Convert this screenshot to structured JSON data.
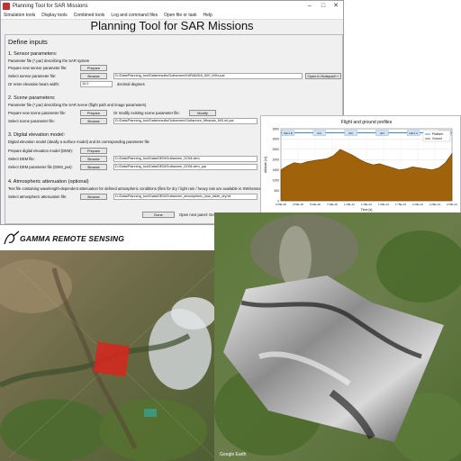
{
  "window": {
    "title": "Planning Tool for SAR Missions",
    "menu": [
      "Simulation tools",
      "Display tools",
      "Combined tools",
      "Log and command files",
      "Open file or task",
      "Help"
    ],
    "app_title": "Planning Tool for SAR Missions",
    "define_inputs": "Define inputs"
  },
  "sensor": {
    "heading": "1. Sensor parameters:",
    "desc": "Parameter file (*.par) describing the SAR system",
    "prepare_label": "Prepare new sensor parameter file:",
    "prepare_btn": "Prepare",
    "select_label": "Select sensor parameter file:",
    "browse_btn": "Browse",
    "path": "D:/Data/Planning_tool/Data/results/Guttannen/KARAMDA_600_MHz.par",
    "notepad_btn": "Open in Notepad++",
    "beam_label": "Or enter elevation beam width:",
    "beam_value": "10.0",
    "beam_unit": "decimal degrees"
  },
  "scene": {
    "heading": "2. Scene parameters:",
    "desc": "Parameter file (*.par) describing the SAR scene (flight path and image parameters)",
    "prepare_label": "Prepare new scene parameter file:",
    "prepare_btn": "Prepare",
    "modify_label": "Or modify existing scene parameter file:",
    "modify_btn": "Modify",
    "select_label": "Select scene parameter file:",
    "browse_btn": "Browse",
    "path": "D:/Data/Planning_tool/Data/results/Guttannen/Guttannen_Miranda_600.ml.par"
  },
  "dem": {
    "heading": "3. Digital elevation model:",
    "desc": "Digital elevation model (ideally a surface model) and its corresponding parameter file",
    "prepare_label": "Prepare digital elevation model (DEM):",
    "prepare_btn": "Prepare",
    "dem_label": "Select DEM file:",
    "dem_browse": "Browse",
    "dem_path": "D:/Data/Planning_tool/Data/DEM/Guttannen_DOM.dem",
    "par_label": "Select DEM parameter file (DEM_par):",
    "par_browse": "Browse",
    "par_path": "D:/Data/Planning_tool/Data/DEM/Guttannen_DOM.dem_par"
  },
  "atm": {
    "heading": "4. Atmospheric attenuation (optional)",
    "desc": "Text file containing wavelength-dependent attenuation for defined atmospheric conditions (files for dry / light rain / heavy rain are available in SW/sensors",
    "select_label": "Select atmospheric attenuation file:",
    "browse_btn": "Browse",
    "path": "D:/Data/Planning_tool/Data/DEM/Guttannen_atmospheric_loss_table_dry.txt"
  },
  "footer": {
    "done_btn": "Done",
    "next_label": "Open next panel: Ge"
  },
  "logo": {
    "brand": "GAMMA REMOTE SENSING"
  },
  "watermark": "Google Earth",
  "colors": {
    "terrain_fill": "#a0620a",
    "platform_line": "#1f77b4",
    "ground_line": "#6b3f00",
    "footprint_red": "#d8261c"
  },
  "chart_data": {
    "type": "area",
    "title": "Flight and ground profiles",
    "xlabel": "Time [s]",
    "ylabel": "Altitude [m]",
    "ylim": [
      0,
      3500
    ],
    "yticks": [
      0,
      500,
      1000,
      1500,
      2000,
      2500,
      3000,
      3500
    ],
    "xlim": [
      0,
      26
    ],
    "xticks": [
      "0.00E+00",
      "2.50E+00",
      "5.00E+00",
      "7.50E+00",
      "1.00E+01",
      "1.25E+01",
      "1.50E+01",
      "1.75E+01",
      "2.00E+01",
      "2.25E+01",
      "2.50E+01"
    ],
    "grid": true,
    "legend": "top-right",
    "series": [
      {
        "name": "Platform",
        "values": [
          3300,
          3300
        ]
      },
      {
        "name": "Ground",
        "x": [
          0,
          1,
          2,
          3,
          4,
          5,
          6,
          7,
          8,
          9,
          10,
          11,
          12,
          13,
          14,
          15,
          16,
          17,
          18,
          19,
          20,
          21,
          22,
          23,
          24,
          25,
          26
        ],
        "values": [
          1500,
          1700,
          1850,
          1800,
          1900,
          1950,
          2000,
          2050,
          2200,
          2500,
          2350,
          2200,
          2000,
          1850,
          1750,
          1800,
          1700,
          1600,
          1500,
          1550,
          1650,
          1600,
          1550,
          1500,
          1600,
          1850,
          2300
        ]
      }
    ],
    "markers": [
      "DE/1 B",
      "ID1",
      "ID2",
      "ID3",
      "DE/1 A",
      "ID4"
    ]
  }
}
